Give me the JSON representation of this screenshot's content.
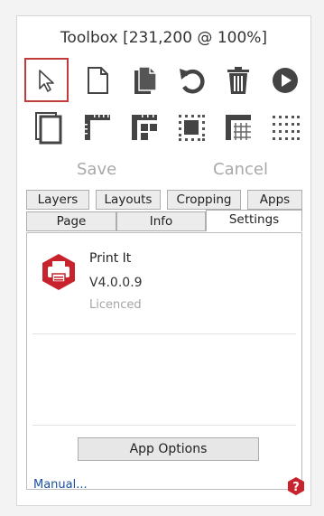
{
  "window": {
    "title": "Toolbox [231,200 @ 100%]"
  },
  "tools": {
    "row1": [
      "pointer-icon",
      "page-icon",
      "pages-icon",
      "rotate-icon",
      "trash-icon",
      "play-icon"
    ],
    "row2": [
      "page-frame-icon",
      "corner-ruler-icon",
      "grid-ruler-icon",
      "crop-marks-icon",
      "ruler-grid-icon",
      "dot-grid-icon"
    ]
  },
  "actions": {
    "save": "Save",
    "cancel": "Cancel"
  },
  "tabs": {
    "back_row": [
      "Layers",
      "Layouts",
      "Cropping",
      "Apps"
    ],
    "front_row": [
      "Page",
      "Info",
      "Settings"
    ],
    "active": "Settings"
  },
  "app": {
    "name": "Print It",
    "version": "V4.0.0.9",
    "status": "Licenced",
    "accent_color": "#c8232c"
  },
  "buttons": {
    "app_options": "App Options"
  },
  "footer": {
    "manual_link": "Manual..."
  }
}
